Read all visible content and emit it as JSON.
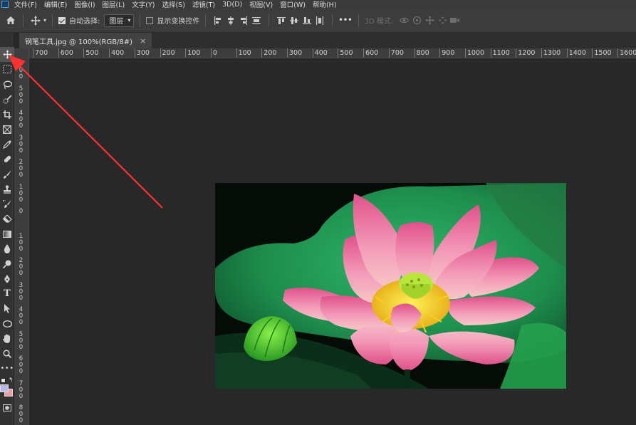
{
  "menubar": {
    "items": [
      "文件(F)",
      "编辑(E)",
      "图像(I)",
      "图层(L)",
      "文字(Y)",
      "选择(S)",
      "滤镜(T)",
      "3D(D)",
      "视图(V)",
      "窗口(W)",
      "帮助(H)"
    ]
  },
  "options": {
    "auto_select_label": "自动选择:",
    "auto_select_value": "图层",
    "show_transform_label": "显示变换控件",
    "mode_3d_label": "3D 模式:",
    "more_label": "•••"
  },
  "document": {
    "tab_title": "钢笔工具.jpg @ 100%(RGB/8#)",
    "close_label": "×"
  },
  "ruler": {
    "h_labels": [
      "700",
      "600",
      "500",
      "400",
      "300",
      "200",
      "100",
      "0",
      "100",
      "200",
      "300",
      "400",
      "500",
      "600",
      "700",
      "800",
      "900",
      "1000",
      "1100",
      "1200",
      "1300",
      "1400",
      "1500",
      "1600"
    ],
    "v_labels": [
      "6 0 0",
      "5 0 0",
      "4 0 0",
      "3 0 0",
      "2 0 0",
      "1 0 0",
      "0",
      "1 0 0",
      "2 0 0",
      "3 0 0",
      "4 0 0",
      "5 0 0",
      "6 0 0",
      "7 0 0",
      "8 0 0"
    ]
  },
  "tools": [
    "move-tool",
    "marquee-tool",
    "lasso-tool",
    "quick-select-tool",
    "crop-tool",
    "frame-tool",
    "eyedropper-tool",
    "healing-brush-tool",
    "brush-tool",
    "clone-stamp-tool",
    "history-brush-tool",
    "eraser-tool",
    "gradient-tool",
    "blur-tool",
    "dodge-tool",
    "pen-tool",
    "type-tool",
    "path-select-tool",
    "ellipse-tool",
    "hand-tool",
    "zoom-tool",
    "more-tools"
  ],
  "colors": {
    "foreground": "#b8b8e8",
    "background": "#e8a0a0",
    "annotation_arrow": "#ff3030"
  }
}
